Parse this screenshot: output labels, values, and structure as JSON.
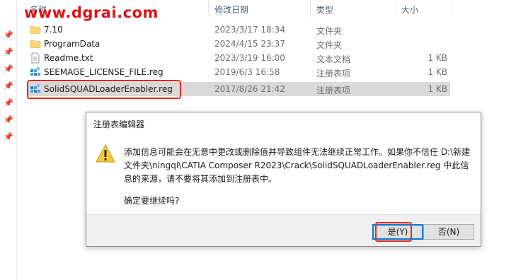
{
  "watermark": "www.dgrai.com",
  "columns": {
    "name": "名称",
    "date": "修改日期",
    "type": "类型",
    "size": "大小"
  },
  "files": [
    {
      "name": "7.10",
      "date": "2023/3/17 18:34",
      "type": "文件夹",
      "size": "",
      "icon": "folder-icon"
    },
    {
      "name": "ProgramData",
      "date": "2024/4/15 23:37",
      "type": "文件夹",
      "size": "",
      "icon": "folder-icon"
    },
    {
      "name": "Readme.txt",
      "date": "2023/3/19 16:00",
      "type": "文本文档",
      "size": "1 KB",
      "icon": "text-file-icon"
    },
    {
      "name": "SEEMAGE_LICENSE_FILE.reg",
      "date": "2019/6/3 16:58",
      "type": "注册表项",
      "size": "1 KB",
      "icon": "registry-file-icon"
    },
    {
      "name": "SolidSQUADLoaderEnabler.reg",
      "date": "2017/8/26 21:42",
      "type": "注册表项",
      "size": "1 KB",
      "icon": "registry-file-icon",
      "selected": true
    }
  ],
  "dialog": {
    "title": "注册表编辑器",
    "message_line1": "添加信息可能会在无意中更改或删除值并导致组件无法继续正常工作。如果你不信任 D:\\新建",
    "message_line2": "文件夹\\ningqi\\CATIA Composer R2023\\Crack\\SolidSQUADLoaderEnabler.reg 中此信",
    "message_line3": "息的来源，请不要将其添加到注册表中。",
    "confirm": "确定要继续吗?",
    "yes_label": "是(Y)",
    "no_label": "否(N)"
  },
  "colors": {
    "highlight": "#e0261f",
    "watermark": "#d9131a",
    "default_button_border": "#0078d7",
    "selected_row": "#d9d9d9"
  }
}
